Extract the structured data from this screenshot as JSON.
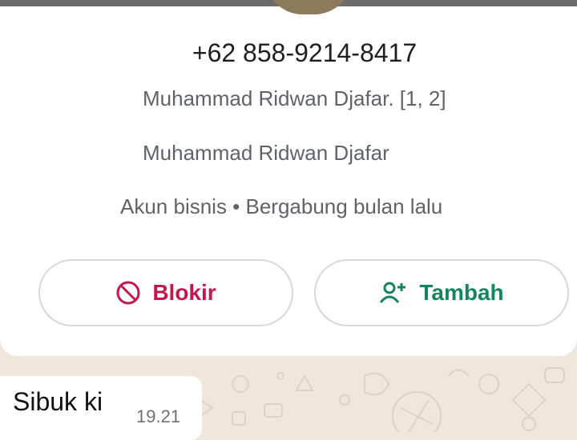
{
  "contact": {
    "phone": "+62 858-9214-8417",
    "push_name": "Muhammad Ridwan Djafar. [1, 2]",
    "about": "Muhammad Ridwan Djafar",
    "account_info": "Akun bisnis • Bergabung bulan lalu"
  },
  "actions": {
    "block": {
      "label": "Blokir",
      "icon": "block-icon",
      "color": "#c2184b"
    },
    "add": {
      "label": "Tambah",
      "icon": "add-person-icon",
      "color": "#15855f"
    }
  },
  "message": {
    "text": "Sibuk ki",
    "time": "19.21"
  },
  "colors": {
    "chat_background": "#efe6dc",
    "card": "#ffffff",
    "secondary_text": "#5f6368"
  }
}
